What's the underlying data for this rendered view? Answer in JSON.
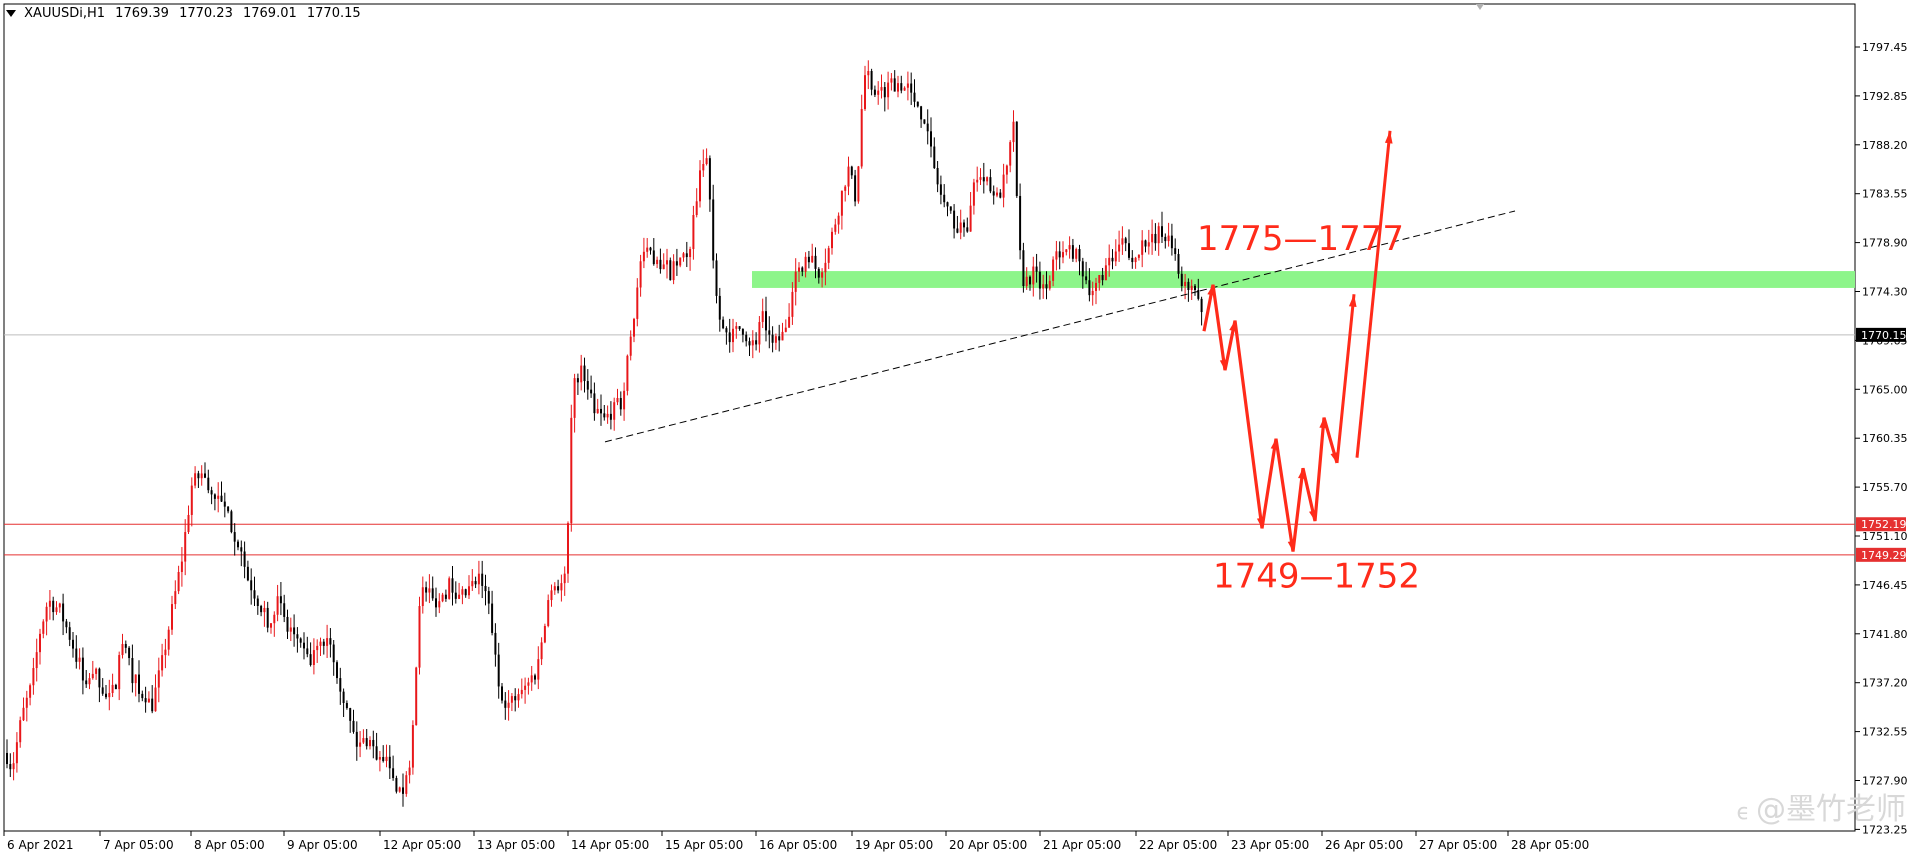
{
  "header": {
    "symbol": "XAUUSDi,H1",
    "open": "1769.39",
    "high": "1770.23",
    "low": "1769.01",
    "close": "1770.15"
  },
  "watermark": {
    "icon": "bamboo-icon",
    "text": "@墨竹老师"
  },
  "colors": {
    "bull": "#e8171a",
    "bear": "#000000",
    "zone": "#8df58a",
    "hline": "#e53030",
    "arrow": "#ff2b1a",
    "annotation": "#ff2b1a",
    "grid_axis": "#000000",
    "price_label_bg": "#000000",
    "level_label_bg": "#e53030"
  },
  "chart_data": {
    "type": "candlestick",
    "title": "",
    "xlabel": "",
    "ylabel": "",
    "ylim": [
      1722.4,
      1800.5
    ],
    "grid": false,
    "y_ticks": [
      "1797.45",
      "1792.85",
      "1788.20",
      "1783.55",
      "1778.90",
      "1774.30",
      "1769.65",
      "1765.00",
      "1760.35",
      "1755.70",
      "1751.10",
      "1746.45",
      "1741.80",
      "1737.20",
      "1732.55",
      "1727.90",
      "1723.25"
    ],
    "x_ticks": [
      "6 Apr 2021",
      "7 Apr 05:00",
      "8 Apr 05:00",
      "9 Apr 05:00",
      "12 Apr 05:00",
      "13 Apr 05:00",
      "14 Apr 05:00",
      "15 Apr 05:00",
      "16 Apr 05:00",
      "19 Apr 05:00",
      "20 Apr 05:00",
      "21 Apr 05:00",
      "22 Apr 05:00",
      "23 Apr 05:00",
      "26 Apr 05:00",
      "27 Apr 05:00",
      "28 Apr 05:00"
    ],
    "price_path": [
      [
        0,
        1732
      ],
      [
        12,
        1729
      ],
      [
        22,
        1734
      ],
      [
        32,
        1737
      ],
      [
        40,
        1742
      ],
      [
        48,
        1745
      ],
      [
        60,
        1744
      ],
      [
        72,
        1741
      ],
      [
        84,
        1737
      ],
      [
        96,
        1738
      ],
      [
        110,
        1735
      ],
      [
        122,
        1741
      ],
      [
        132,
        1738
      ],
      [
        142,
        1736
      ],
      [
        152,
        1735
      ],
      [
        162,
        1739
      ],
      [
        172,
        1744
      ],
      [
        182,
        1749
      ],
      [
        192,
        1756
      ],
      [
        202,
        1757
      ],
      [
        212,
        1755
      ],
      [
        222,
        1754
      ],
      [
        232,
        1752
      ],
      [
        240,
        1750
      ],
      [
        248,
        1747
      ],
      [
        258,
        1745
      ],
      [
        268,
        1743
      ],
      [
        278,
        1745
      ],
      [
        288,
        1742
      ],
      [
        298,
        1741
      ],
      [
        308,
        1739
      ],
      [
        318,
        1740
      ],
      [
        328,
        1742
      ],
      [
        338,
        1738
      ],
      [
        348,
        1734
      ],
      [
        358,
        1731
      ],
      [
        368,
        1732
      ],
      [
        378,
        1730
      ],
      [
        388,
        1729
      ],
      [
        398,
        1726
      ],
      [
        408,
        1728
      ],
      [
        414,
        1735
      ],
      [
        420,
        1746
      ],
      [
        430,
        1745
      ],
      [
        440,
        1745
      ],
      [
        450,
        1747
      ],
      [
        460,
        1745
      ],
      [
        470,
        1746
      ],
      [
        480,
        1747
      ],
      [
        490,
        1744
      ],
      [
        498,
        1737
      ],
      [
        508,
        1735
      ],
      [
        518,
        1736
      ],
      [
        528,
        1737
      ],
      [
        538,
        1739
      ],
      [
        548,
        1745
      ],
      [
        558,
        1747
      ],
      [
        564,
        1746
      ],
      [
        568,
        1752
      ],
      [
        572,
        1764
      ],
      [
        578,
        1767
      ],
      [
        586,
        1766
      ],
      [
        596,
        1763
      ],
      [
        604,
        1762
      ],
      [
        612,
        1763
      ],
      [
        620,
        1763
      ],
      [
        628,
        1768
      ],
      [
        634,
        1772
      ],
      [
        640,
        1777
      ],
      [
        650,
        1778
      ],
      [
        660,
        1777
      ],
      [
        670,
        1776
      ],
      [
        680,
        1777
      ],
      [
        690,
        1778
      ],
      [
        700,
        1786
      ],
      [
        708,
        1787
      ],
      [
        714,
        1776
      ],
      [
        722,
        1771
      ],
      [
        732,
        1770
      ],
      [
        742,
        1771
      ],
      [
        752,
        1769
      ],
      [
        762,
        1772
      ],
      [
        772,
        1769
      ],
      [
        782,
        1770
      ],
      [
        790,
        1772
      ],
      [
        798,
        1777
      ],
      [
        808,
        1778
      ],
      [
        818,
        1776
      ],
      [
        828,
        1778
      ],
      [
        838,
        1782
      ],
      [
        848,
        1786
      ],
      [
        856,
        1783
      ],
      [
        864,
        1795
      ],
      [
        872,
        1793
      ],
      [
        880,
        1793
      ],
      [
        890,
        1794
      ],
      [
        900,
        1794
      ],
      [
        910,
        1793
      ],
      [
        918,
        1792
      ],
      [
        926,
        1790
      ],
      [
        934,
        1786
      ],
      [
        942,
        1783
      ],
      [
        950,
        1782
      ],
      [
        958,
        1780
      ],
      [
        968,
        1781
      ],
      [
        978,
        1786
      ],
      [
        988,
        1784
      ],
      [
        998,
        1783
      ],
      [
        1008,
        1786
      ],
      [
        1014,
        1791
      ],
      [
        1018,
        1779
      ],
      [
        1024,
        1775
      ],
      [
        1034,
        1776
      ],
      [
        1044,
        1774
      ],
      [
        1054,
        1777
      ],
      [
        1064,
        1779
      ],
      [
        1074,
        1778
      ],
      [
        1084,
        1776
      ],
      [
        1092,
        1774
      ],
      [
        1102,
        1776
      ],
      [
        1112,
        1777
      ],
      [
        1122,
        1779
      ],
      [
        1132,
        1777
      ],
      [
        1142,
        1779
      ],
      [
        1152,
        1779
      ],
      [
        1162,
        1780
      ],
      [
        1170,
        1779
      ],
      [
        1178,
        1776
      ],
      [
        1186,
        1775
      ],
      [
        1194,
        1775
      ],
      [
        1200,
        1773
      ],
      [
        1204,
        1770
      ]
    ],
    "levels": [
      {
        "label": "1752.19",
        "value": 1752.19
      },
      {
        "label": "1749.29",
        "value": 1749.29
      }
    ],
    "current_price": {
      "label": "1770.15",
      "value": 1770.15
    },
    "resistance_zone": {
      "low": 1774.6,
      "high": 1776.2
    },
    "trendline": {
      "x1": 605,
      "y1": 1760.0,
      "x2": 1515,
      "y2": 1781.9,
      "solid_until_x": 1200
    },
    "projection_path": [
      [
        1204,
        1770.5
      ],
      [
        1213,
        1774.9
      ],
      [
        1225,
        1766.8
      ],
      [
        1235,
        1771.5
      ],
      [
        1262,
        1751.8
      ],
      [
        1276,
        1760.3
      ],
      [
        1293,
        1749.6
      ],
      [
        1303,
        1757.5
      ],
      [
        1315,
        1752.5
      ],
      [
        1324,
        1762.3
      ],
      [
        1337,
        1758.0
      ]
    ],
    "projection_arrows": [
      {
        "from": [
          1337,
          1758.0
        ],
        "to": [
          1354,
          1774.0
        ]
      },
      {
        "from": [
          1357,
          1758.5
        ],
        "to": [
          1390,
          1789.5
        ]
      }
    ],
    "annotations": [
      {
        "text": "1775—1777",
        "price": 1778.2,
        "x": 1197
      },
      {
        "text": "1749—1752",
        "price": 1746.2,
        "x": 1213
      }
    ]
  }
}
